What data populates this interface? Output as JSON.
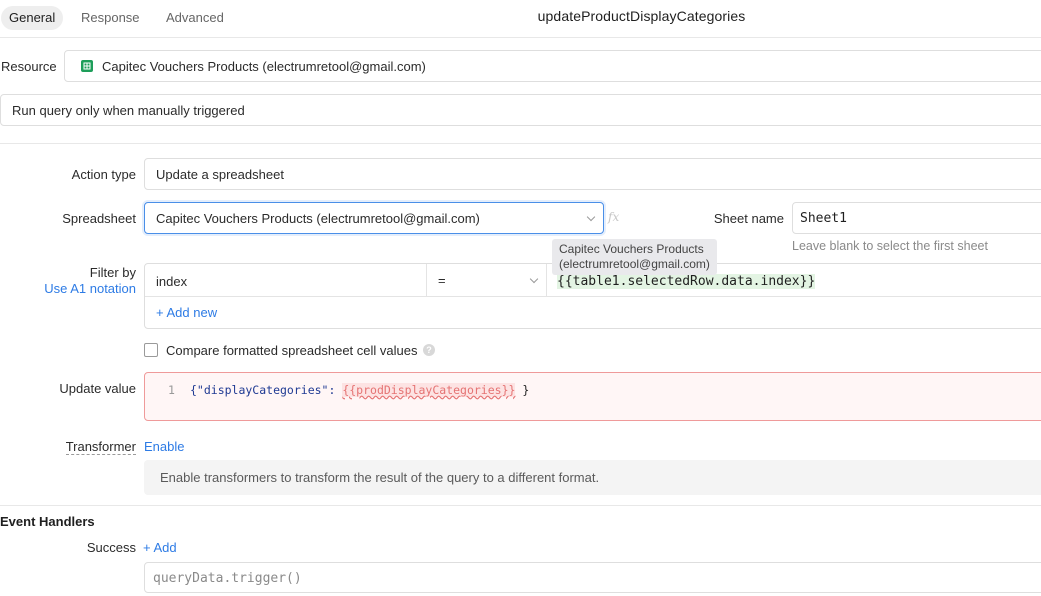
{
  "tabs": [
    {
      "label": "General"
    },
    {
      "label": "Response"
    },
    {
      "label": "Advanced"
    }
  ],
  "query_name": "updateProductDisplayCategories",
  "resource": {
    "label": "Resource",
    "value": "Capitec Vouchers Products (electrumretool@gmail.com)",
    "icon": "google-sheets-icon"
  },
  "trigger": {
    "value": "Run query only when manually triggered"
  },
  "action_type": {
    "label": "Action type",
    "value": "Update a spreadsheet"
  },
  "spreadsheet": {
    "label": "Spreadsheet",
    "value": "Capitec Vouchers Products (electrumretool@gmail.com)",
    "fx": "fx"
  },
  "sheet_name": {
    "label": "Sheet name",
    "value": "Sheet1",
    "hint": "Leave blank to select the first sheet"
  },
  "tooltip": {
    "line1": "Capitec Vouchers Products",
    "line2": "(electrumretool@gmail.com)"
  },
  "filter": {
    "label": "Filter by",
    "a1_link": "Use A1 notation",
    "column": "index",
    "operator": "=",
    "value": "{{table1.selectedRow.data.index}}",
    "add_new": "+ Add new"
  },
  "compare_formatted": {
    "label": "Compare formatted spreadsheet cell values",
    "checked": false
  },
  "update_value": {
    "label": "Update value",
    "line_number": "1",
    "code_prefix": "{\"displayCategories\": ",
    "code_template": "{{prodDisplayCategories}}",
    "code_suffix": " }"
  },
  "transformer": {
    "label": "Transformer",
    "enable_link": "Enable",
    "description": "Enable transformers to transform the result of the query to a different format."
  },
  "event_handlers": {
    "heading": "Event Handlers",
    "success_label": "Success",
    "add_link": "+ Add",
    "success_placeholder": "queryData.trigger()"
  }
}
